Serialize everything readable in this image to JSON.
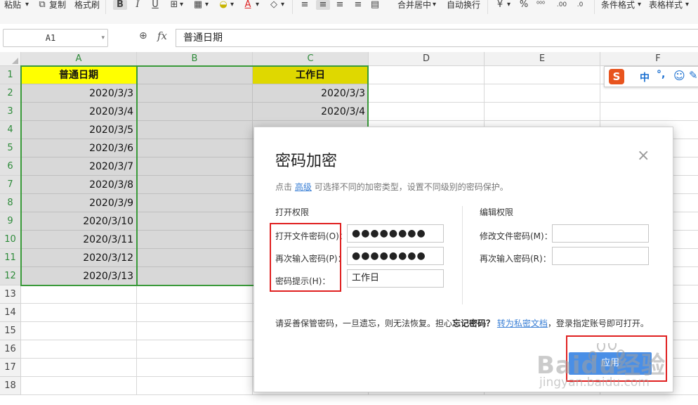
{
  "ribbon": {
    "paste": "粘贴",
    "copy": "复制",
    "format_painter": "格式刷",
    "bold": "B",
    "italic": "I",
    "underline": "U",
    "font_color_letter": "A",
    "merge_center": "合并居中",
    "wrap_text": "自动换行",
    "percent": "%",
    "conditional_format": "条件格式",
    "table_style": "表格样式"
  },
  "formula_bar": {
    "name_box": "A1",
    "fx": "fx",
    "content": "普通日期"
  },
  "columns": [
    "A",
    "B",
    "C",
    "D",
    "E",
    "F"
  ],
  "rows": [
    "1",
    "2",
    "3",
    "4",
    "5",
    "6",
    "7",
    "8",
    "9",
    "10",
    "11",
    "12",
    "13",
    "14",
    "15",
    "16",
    "17",
    "18"
  ],
  "sheet": {
    "a1": "普通日期",
    "c1": "工作日",
    "col_a": [
      "2020/3/3",
      "2020/3/4",
      "2020/3/5",
      "2020/3/6",
      "2020/3/7",
      "2020/3/8",
      "2020/3/9",
      "2020/3/10",
      "2020/3/11",
      "2020/3/12",
      "2020/3/13"
    ],
    "col_c": [
      "2020/3/3",
      "2020/3/4"
    ]
  },
  "ime_bar": {
    "logo": "S",
    "mode": "中",
    "punct": "°,"
  },
  "dialog": {
    "title": "密码加密",
    "close": "×",
    "hint_prefix": "点击",
    "hint_link": "高级",
    "hint_suffix": "可选择不同的加密类型，设置不同级别的密码保护。",
    "open_section": "打开权限",
    "edit_section": "编辑权限",
    "open_password_label": "打开文件密码(O)：",
    "open_password_value": "●●●●●●●●",
    "open_confirm_label": "再次输入密码(P)：",
    "open_confirm_value": "●●●●●●●●",
    "hint_label": "密码提示(H)：",
    "hint_value": "工作日",
    "edit_password_label": "修改文件密码(M)：",
    "edit_password_value": "",
    "edit_confirm_label": "再次输入密码(R)：",
    "edit_confirm_value": "",
    "warn_text": "请妥善保管密码，一旦遗忘，则无法恢复。担心",
    "warn_bold": "忘记密码？",
    "warn_link": "转为私密文档",
    "warn_suffix": "，登录指定账号即可打开。",
    "ok": "应用"
  },
  "watermark": {
    "line1": "Baidu经验",
    "line2": "jingyan.baidu.com"
  }
}
